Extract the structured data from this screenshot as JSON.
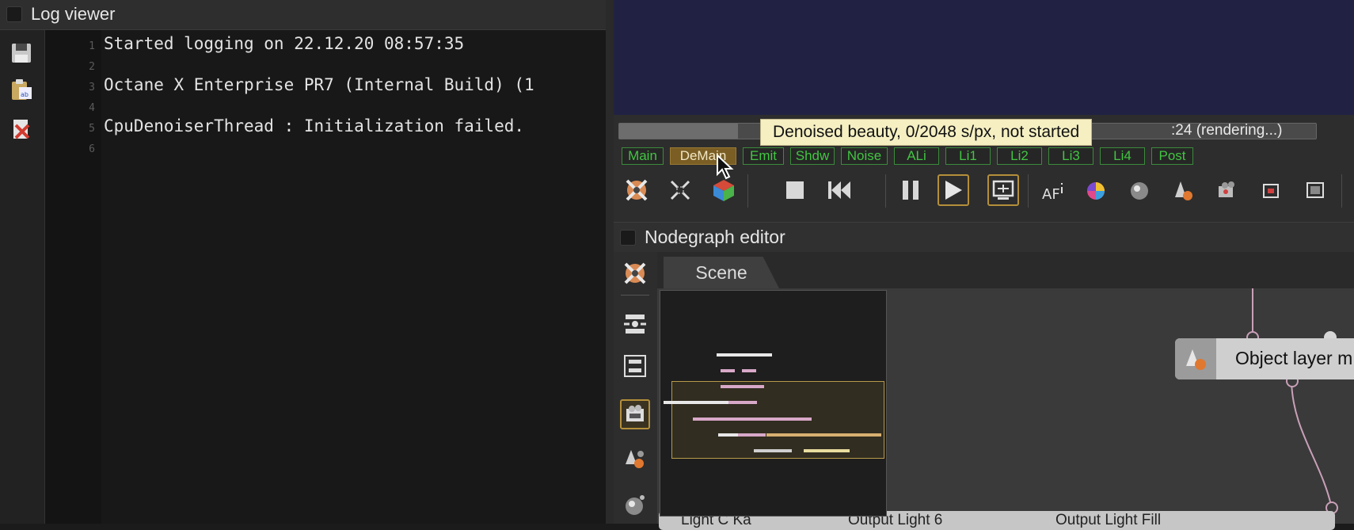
{
  "log_viewer": {
    "title": "Log viewer",
    "sidebar_icons": [
      "save-icon",
      "clipboard-icon",
      "clear-log-icon"
    ],
    "lines": [
      {
        "num": "1",
        "text": "Started logging on 22.12.20 08:57:35"
      },
      {
        "num": "2",
        "text": ""
      },
      {
        "num": "3",
        "text": "Octane X Enterprise PR7 (Internal Build) (1"
      },
      {
        "num": "4",
        "text": ""
      },
      {
        "num": "5",
        "text": "CpuDenoiserThread : Initialization failed."
      },
      {
        "num": "6",
        "text": ""
      }
    ]
  },
  "render": {
    "progress": 0.17,
    "status_text": ":24 (rendering...)",
    "tooltip": "Denoised beauty, 0/2048 s/px, not started",
    "pass_tabs": [
      "Main",
      "DeMain",
      "Emit",
      "Shdw",
      "Noise",
      "ALi",
      "Li1",
      "Li2",
      "Li3",
      "Li4",
      "Post"
    ],
    "active_pass": "DeMain"
  },
  "toolbar": {
    "buttons": [
      "recenter-icon",
      "fit-icon",
      "cube-icon",
      "stop-icon",
      "rewind-icon",
      "pause-icon",
      "play-icon",
      "region-icon",
      "af-icon",
      "color-icon",
      "sphere-icon",
      "object-icon",
      "camera-icon",
      "film-icon",
      "viewport-icon"
    ]
  },
  "nodegraph": {
    "title": "Nodegraph editor",
    "tab": "Scene",
    "node_label": "Object layer m",
    "bottom_nodes": [
      "Light C Ka",
      "Output Light 6",
      "Output Light Fill"
    ]
  },
  "colors": {
    "accent": "#b48f3a",
    "pass_green": "#42c542",
    "tooltip_bg": "#f5efc2",
    "render_bg": "#212243"
  }
}
